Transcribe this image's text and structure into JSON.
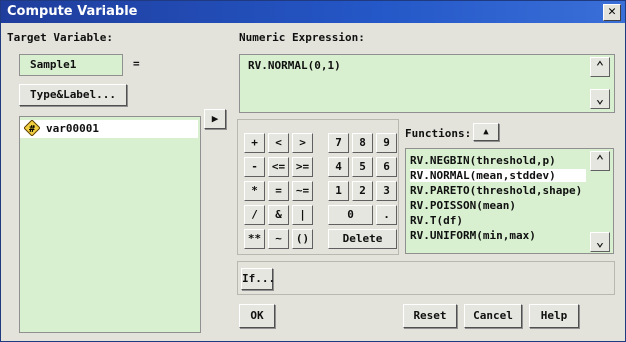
{
  "window": {
    "title": "Compute Variable",
    "close": "✕"
  },
  "target": {
    "label": "Target Variable:",
    "value": "Sample1",
    "equals": "=",
    "type_label_button": "Type&Label..."
  },
  "variables": [
    {
      "name": "var00001",
      "icon": "#"
    }
  ],
  "move_button": "▶",
  "expression": {
    "label": "Numeric Expression:",
    "value": "RV.NORMAL(0,1)"
  },
  "keypad": {
    "keys": [
      "+",
      "<",
      ">",
      "7",
      "8",
      "9",
      "-",
      "<=",
      ">=",
      "4",
      "5",
      "6",
      "*",
      "=",
      "~=",
      "1",
      "2",
      "3",
      "/",
      "&",
      "|",
      "0",
      ".",
      "**",
      "~",
      "()"
    ],
    "delete": "Delete"
  },
  "functions": {
    "label": "Functions:",
    "items": [
      "RV.NEGBIN(threshold,p)",
      "RV.NORMAL(mean,stddev)",
      "RV.PARETO(threshold,shape)",
      "RV.POISSON(mean)",
      "RV.T(df)",
      "RV.UNIFORM(min,max)"
    ],
    "selected_index": 1
  },
  "buttons": {
    "if": "If...",
    "ok": "OK",
    "reset": "Reset",
    "cancel": "Cancel",
    "help": "Help"
  },
  "colors": {
    "title_bar": "#2457c7",
    "field_bg": "#d8f0d0"
  }
}
